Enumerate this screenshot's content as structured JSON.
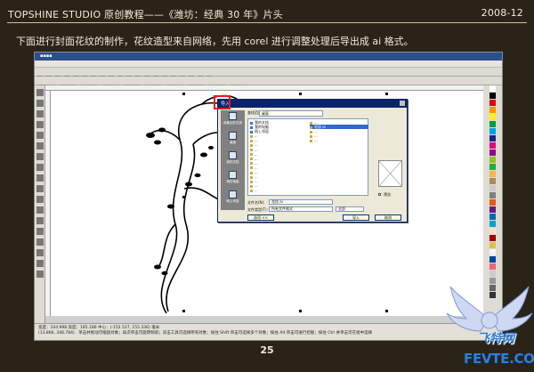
{
  "header": {
    "title": "TOPSHINE STUDIO 原创教程——《潍坊：经典 30 年》片头",
    "date": "2008-12"
  },
  "description": "下面进行封面花纹的制作，花纹造型来自网络，先用 corel 进行调整处理后导出成 ai 格式。",
  "dialog": {
    "title": "导入",
    "look_in_label": "查找范围(I):",
    "look_in_value": "桌面",
    "places": [
      "我最近的文档",
      "桌面",
      "我的文档",
      "我的电脑",
      "网上邻居"
    ],
    "files_left": [
      "我的文档",
      "我的电脑",
      "网上邻居",
      "...",
      "...",
      "...",
      "...",
      "...",
      "...",
      "...",
      "...",
      "...",
      "...",
      "...",
      "...",
      "..."
    ],
    "files_right": [
      "...",
      "花纹.ai",
      "...",
      "...",
      "..."
    ],
    "filename_label": "文件名(N):",
    "filename_value": "花纹.ai",
    "filetype_label": "文件类型(T):",
    "filetype_value": "所有文件格式",
    "sort_value": "全部",
    "options_button": "选项 <<",
    "import_button": "导入",
    "cancel_button": "取消",
    "preview_label": "预览"
  },
  "status_bar": {
    "line1": "宽度：104.998 高度：185.186 中心：(-152.527, 155.336) 毫米",
    "line2": "(13.866, 346.784)　单击并拖动可缩放对象；再次单击可旋转倾斜；双击工具可选择所有对象；按住 Shift 单击可选择多个对象；按住 Alt 单击可进行挖掘；按住 Ctrl 并单击可在组中选择"
  },
  "page_number": "25",
  "watermark": {
    "text_cn": "飞特网",
    "text_en": "FEVTE.COM"
  },
  "palette_colors": [
    "#ffffff",
    "#000000",
    "#e60012",
    "#f39800",
    "#fff100",
    "#009944",
    "#00a0e9",
    "#1d2088",
    "#e4007f",
    "#920783",
    "#8fc31f",
    "#22ac38",
    "#f8b551",
    "#b28850",
    "#c9caca",
    "#7f7f7f",
    "#ea5514",
    "#601986",
    "#0068b7",
    "#00a7c2",
    "#fce2c4",
    "#a40000",
    "#d7c447",
    "#f2f2f2",
    "#00479d",
    "#eb6877",
    "#ccc",
    "#999",
    "#666",
    "#333"
  ]
}
